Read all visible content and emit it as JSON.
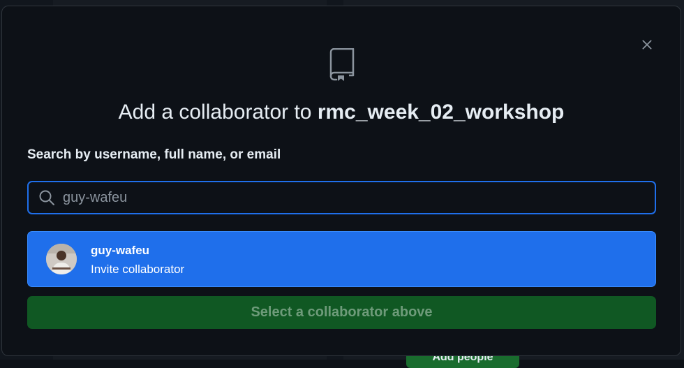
{
  "background": {
    "button_label": "Add people"
  },
  "modal": {
    "title_prefix": "Add a collaborator to ",
    "repo_name": "rmc_week_02_workshop",
    "search_label": "Search by username, full name, or email",
    "search_value": "guy-wafeu",
    "result": {
      "username": "guy-wafeu",
      "action": "Invite collaborator"
    },
    "submit_label": "Select a collaborator above"
  },
  "icons": {
    "close": "close-icon",
    "repo": "repo-icon",
    "search": "search-icon"
  },
  "colors": {
    "accent": "#1f6feb",
    "submit_disabled": "#105823",
    "background": "#0d1117"
  }
}
